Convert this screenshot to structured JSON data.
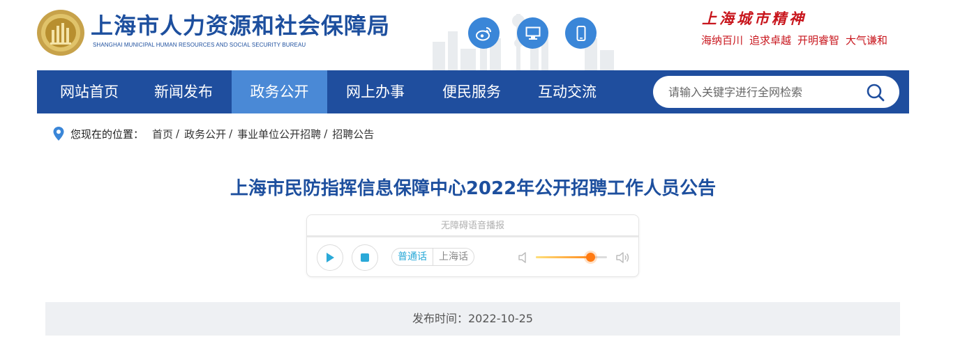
{
  "header": {
    "title": "上海市人力资源和社会保障局",
    "subtitle": "SHANGHAI MUNICIPAL HUMAN RESOURCES AND SOCIAL SECURITY BUREAU",
    "logo_icon": "bureau-emblem-icon",
    "social_icons": [
      "weibo-icon",
      "desktop-icon",
      "mobile-icon"
    ],
    "spirit_title": "上海城市精神",
    "spirit_phrases": [
      "海纳百川",
      "追求卓越",
      "开明睿智",
      "大气谦和"
    ]
  },
  "nav": {
    "items": [
      {
        "label": "网站首页"
      },
      {
        "label": "新闻发布"
      },
      {
        "label": "政务公开"
      },
      {
        "label": "网上办事"
      },
      {
        "label": "便民服务"
      },
      {
        "label": "互动交流"
      }
    ],
    "active_index": 2,
    "search": {
      "placeholder": "请输入关键字进行全网检索",
      "value": ""
    }
  },
  "breadcrumb": {
    "prefix": "您现在的位置：",
    "items": [
      "首页",
      "政务公开",
      "事业单位公开招聘",
      "招聘公告"
    ],
    "separator": "/"
  },
  "article": {
    "title": "上海市民防指挥信息保障中心2022年公开招聘工作人员公告",
    "publish": "发布时间：2022-10-25"
  },
  "player": {
    "header": "无障碍语音播报",
    "lang_options": [
      "普通话",
      "上海话"
    ],
    "selected_lang": "普通话",
    "playback_progress": 0,
    "volume": 0.76
  },
  "colors": {
    "brand_blue": "#1f4e9e",
    "nav_active": "#4a89d6",
    "spirit_red": "#c8161d",
    "icon_blue": "#3a86d8",
    "volume_orange": "#ff7a12"
  }
}
